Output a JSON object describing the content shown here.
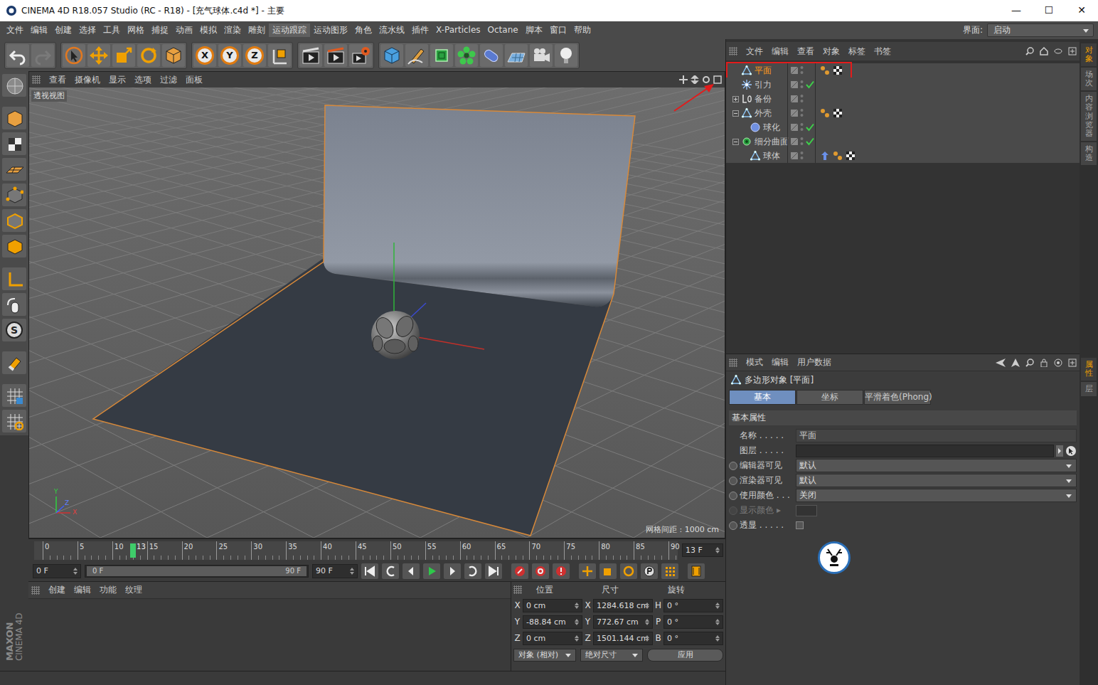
{
  "window": {
    "title": "CINEMA 4D R18.057 Studio (RC - R18) - [充气球体.c4d *] - 主要",
    "controls": [
      "—",
      "☐",
      "✕"
    ]
  },
  "menu": [
    {
      "label": "文件",
      "selected": false
    },
    {
      "label": "编辑",
      "selected": false
    },
    {
      "label": "创建",
      "selected": false
    },
    {
      "label": "选择",
      "selected": false
    },
    {
      "label": "工具",
      "selected": false
    },
    {
      "label": "网格",
      "selected": false
    },
    {
      "label": "捕捉",
      "selected": false
    },
    {
      "label": "动画",
      "selected": false
    },
    {
      "label": "模拟",
      "selected": false
    },
    {
      "label": "渲染",
      "selected": false
    },
    {
      "label": "雕刻",
      "selected": false
    },
    {
      "label": "运动跟踪",
      "selected": true
    },
    {
      "label": "运动图形",
      "selected": false
    },
    {
      "label": "角色",
      "selected": false
    },
    {
      "label": "流水线",
      "selected": false
    },
    {
      "label": "插件",
      "selected": false
    },
    {
      "label": "X-Particles",
      "selected": false
    },
    {
      "label": "Octane",
      "selected": false
    },
    {
      "label": "脚本",
      "selected": false
    },
    {
      "label": "窗口",
      "selected": false
    },
    {
      "label": "帮助",
      "selected": false
    }
  ],
  "interface": {
    "label": "界面:",
    "value": "启动"
  },
  "toolbar": {
    "axis_locks": [
      {
        "label": "X",
        "on": true
      },
      {
        "label": "Y",
        "on": true
      },
      {
        "label": "Z",
        "on": true
      }
    ]
  },
  "left_tools": {
    "snap_label": "S"
  },
  "viewport": {
    "menu": [
      "查看",
      "摄像机",
      "显示",
      "选项",
      "过滤",
      "面板"
    ],
    "label": "透视视图",
    "grid_spacing": "网格间距 : 1000 cm",
    "axes": [
      "Y",
      "Z",
      "X"
    ]
  },
  "timeline": {
    "ticks": [
      "0",
      "5",
      "10",
      "15",
      "20",
      "25",
      "30",
      "35",
      "40",
      "45",
      "50",
      "55",
      "60",
      "65",
      "70",
      "75",
      "80",
      "85",
      "90"
    ],
    "current": "13",
    "frame_field": "13 F"
  },
  "playback": {
    "start": "0 F",
    "range_start": "0 F",
    "range_end": "90 F",
    "end": "90 F"
  },
  "materials": {
    "menu": [
      "创建",
      "编辑",
      "功能",
      "纹理"
    ]
  },
  "coordinates": {
    "headers": [
      "位置",
      "尺寸",
      "旋转"
    ],
    "rows": [
      {
        "pos_axis": "X",
        "pos": "0 cm",
        "size_axis": "X",
        "size": "1284.618 cm",
        "rot_axis": "H",
        "rot": "0 °"
      },
      {
        "pos_axis": "Y",
        "pos": "-88.84 cm",
        "size_axis": "Y",
        "size": "772.67 cm",
        "rot_axis": "P",
        "rot": "0 °"
      },
      {
        "pos_axis": "Z",
        "pos": "0 cm",
        "size_axis": "Z",
        "size": "1501.144 cm",
        "rot_axis": "B",
        "rot": "0 °"
      }
    ],
    "mode": "对象 (相对)",
    "size_mode": "绝对尺寸",
    "apply": "应用"
  },
  "objects": {
    "menu": [
      "文件",
      "编辑",
      "查看",
      "对象",
      "标签",
      "书签"
    ],
    "items": [
      {
        "name": "平面",
        "depth": 0,
        "kind": "polygon",
        "children": false,
        "expanded": false,
        "selected": true,
        "annotated": true,
        "check": false,
        "tags": [
          "phong",
          "material"
        ]
      },
      {
        "name": "引力",
        "depth": 0,
        "kind": "force",
        "children": false,
        "expanded": false,
        "selected": false,
        "annotated": false,
        "check": true,
        "tags": []
      },
      {
        "name": "备份",
        "depth": 0,
        "kind": "null",
        "children": true,
        "expanded": false,
        "selected": false,
        "annotated": false,
        "check": false,
        "tags": []
      },
      {
        "name": "外壳",
        "depth": 0,
        "kind": "polygon",
        "children": true,
        "expanded": true,
        "selected": false,
        "annotated": false,
        "check": false,
        "tags": [
          "phong",
          "material"
        ]
      },
      {
        "name": "球化",
        "depth": 1,
        "kind": "deformer",
        "children": false,
        "expanded": false,
        "selected": false,
        "annotated": false,
        "check": true,
        "tags": []
      },
      {
        "name": "细分曲面",
        "depth": 0,
        "kind": "generator",
        "children": true,
        "expanded": true,
        "selected": false,
        "annotated": false,
        "check": true,
        "tags": []
      },
      {
        "name": "球体",
        "depth": 1,
        "kind": "polygon",
        "children": false,
        "expanded": false,
        "selected": false,
        "annotated": false,
        "check": false,
        "tags": [
          "selection",
          "phong",
          "material"
        ]
      }
    ]
  },
  "attributes": {
    "menu": [
      "模式",
      "编辑",
      "用户数据"
    ],
    "title": "多边形对象 [平面]",
    "tabs": [
      {
        "label": "基本",
        "selected": true
      },
      {
        "label": "坐标",
        "selected": false
      },
      {
        "label": "平滑着色(Phong)",
        "selected": false
      }
    ],
    "section": "基本属性",
    "fields": [
      {
        "kind": "text",
        "label": "名称 . . . . .",
        "value": "平面",
        "radio": false,
        "disabled": false
      },
      {
        "kind": "layer",
        "label": "图层 . . . . .",
        "radio": false,
        "disabled": false
      },
      {
        "kind": "select",
        "label": "编辑器可见",
        "value": "默认",
        "radio": true,
        "disabled": false
      },
      {
        "kind": "select",
        "label": "渲染器可见",
        "value": "默认",
        "radio": true,
        "disabled": false
      },
      {
        "kind": "select",
        "label": "使用颜色 . . .",
        "value": "关闭",
        "radio": true,
        "disabled": false
      },
      {
        "kind": "color",
        "label": "显示颜色",
        "marker": "▸",
        "radio": true,
        "disabled": true
      },
      {
        "kind": "checkbox",
        "label": "透显 . . . . .",
        "checked": false,
        "radio": true,
        "disabled": false
      }
    ]
  },
  "side_tabs": {
    "top": [
      {
        "label": "对象",
        "selected": true
      },
      {
        "label": "场次",
        "selected": false
      },
      {
        "label": "内容浏览器",
        "selected": false
      },
      {
        "label": "构造",
        "selected": false
      }
    ],
    "bottom": [
      {
        "label": "属性",
        "selected": true
      },
      {
        "label": "层",
        "selected": false
      }
    ]
  },
  "logo": {
    "lines": [
      "MAXON",
      "CINEMA 4D"
    ]
  }
}
